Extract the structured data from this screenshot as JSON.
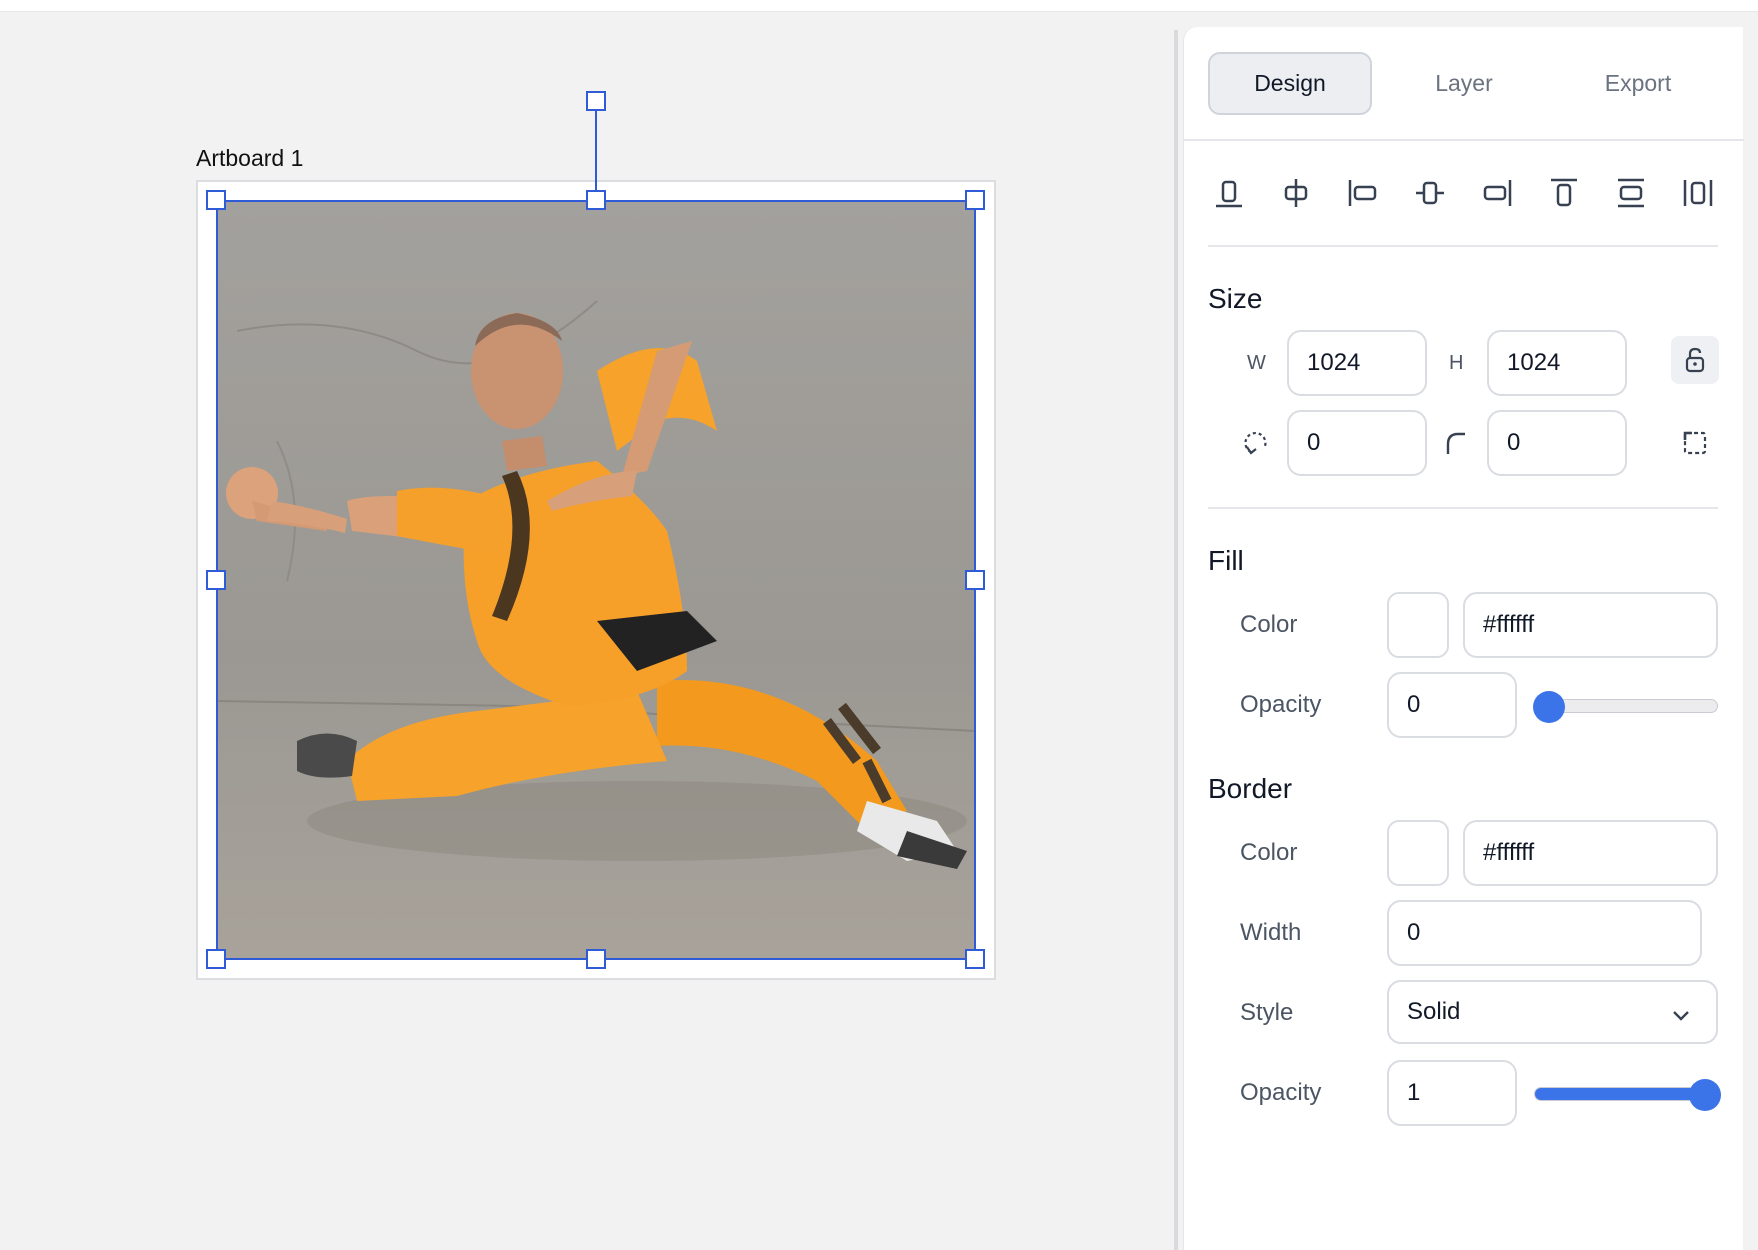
{
  "canvas": {
    "artboard_label": "Artboard 1"
  },
  "panel": {
    "tabs": [
      {
        "label": "Design",
        "active": true
      },
      {
        "label": "Layer",
        "active": false
      },
      {
        "label": "Export",
        "active": false
      }
    ],
    "align_icons": [
      "align-bottom-icon",
      "align-horizontal-center-icon",
      "align-left-icon",
      "align-vertical-center-icon",
      "align-right-icon",
      "align-top-icon",
      "distribute-vertical-icon",
      "distribute-horizontal-icon"
    ],
    "size": {
      "title": "Size",
      "w_label": "W",
      "w_value": "1024",
      "h_label": "H",
      "h_value": "1024",
      "rotation_value": "0",
      "radius_value": "0"
    },
    "fill": {
      "title": "Fill",
      "color_label": "Color",
      "color_value": "#ffffff",
      "opacity_label": "Opacity",
      "opacity_value": "0",
      "opacity_level": 0
    },
    "border": {
      "title": "Border",
      "color_label": "Color",
      "color_value": "#ffffff",
      "width_label": "Width",
      "width_value": "0",
      "style_label": "Style",
      "style_value": "Solid",
      "opacity_label": "Opacity",
      "opacity_value": "1",
      "opacity_level": 1
    }
  },
  "colors": {
    "accent": "#3b73e8",
    "selection": "#2f5bd6",
    "robe": "#f39a1e"
  }
}
